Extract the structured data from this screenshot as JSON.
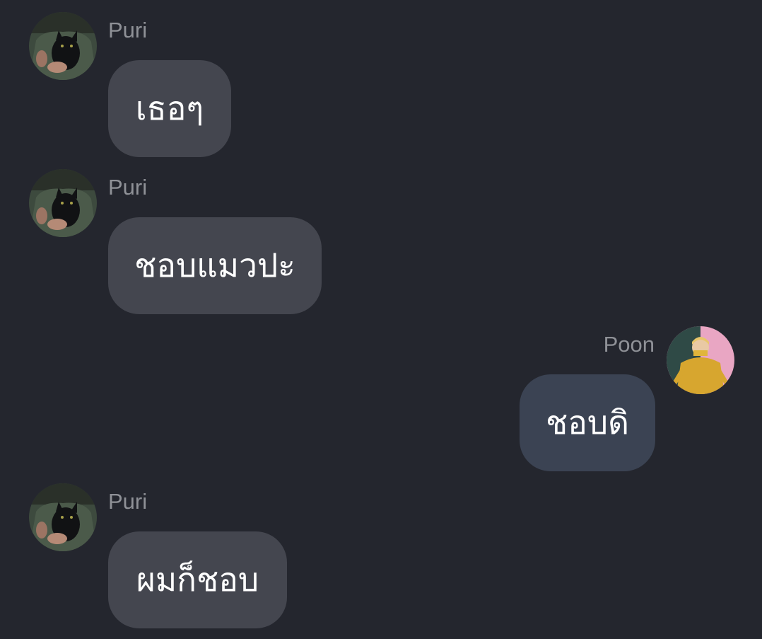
{
  "colors": {
    "background": "#24262e",
    "incoming_bubble": "#44464f",
    "outgoing_bubble": "#3b4353",
    "name_text": "#8f9197",
    "message_text": "#ffffff"
  },
  "messages": [
    {
      "sender": "Puri",
      "text": "เธอๆ",
      "direction": "incoming",
      "avatar": "cat-photo-avatar"
    },
    {
      "sender": "Puri",
      "text": "ชอบแมวปะ",
      "direction": "incoming",
      "avatar": "cat-photo-avatar"
    },
    {
      "sender": "Poon",
      "text": "ชอบดิ",
      "direction": "outgoing",
      "avatar": "yellow-sweater-photo-avatar"
    },
    {
      "sender": "Puri",
      "text": "ผมก็ชอบ",
      "direction": "incoming",
      "avatar": "cat-photo-avatar"
    }
  ]
}
